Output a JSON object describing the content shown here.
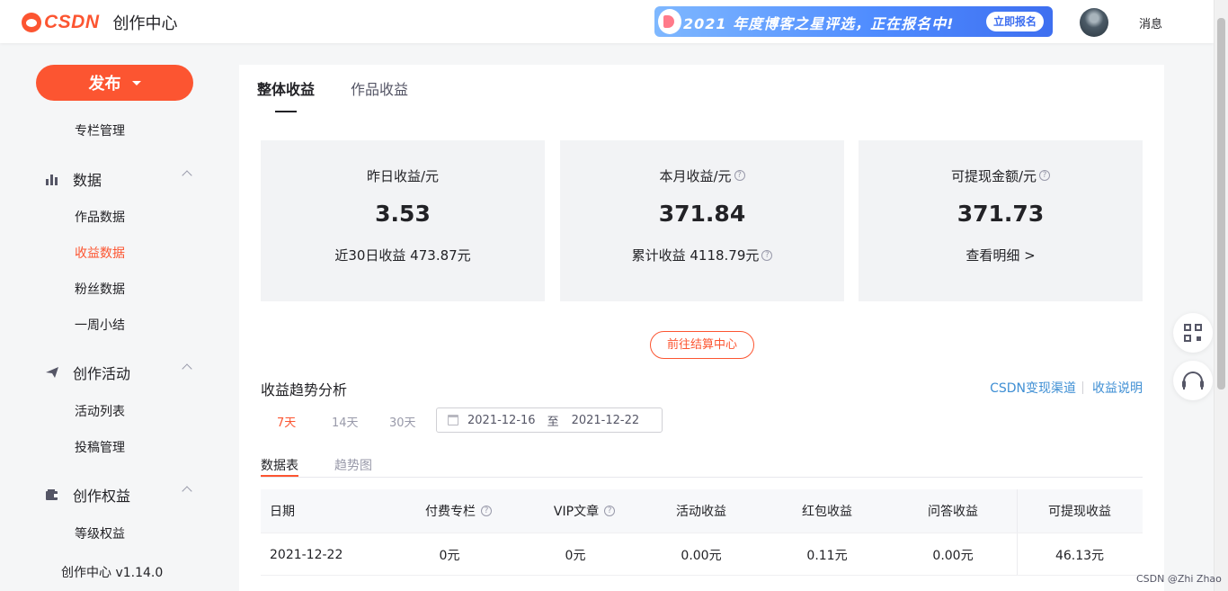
{
  "header": {
    "logo_text": "CSDN",
    "app_title": "创作中心",
    "banner_text": "2021 年度博客之星评选，正在报名中!",
    "banner_button": "立即报名",
    "messages_label": "消息"
  },
  "sidebar": {
    "publish_label": "发布",
    "column_manage": "专栏管理",
    "groups": [
      {
        "label": "数据",
        "icon": "bar-chart-icon",
        "items": [
          "作品数据",
          "收益数据",
          "粉丝数据",
          "一周小结"
        ],
        "active_item": "收益数据"
      },
      {
        "label": "创作活动",
        "icon": "paper-plane-icon",
        "items": [
          "活动列表",
          "投稿管理"
        ]
      },
      {
        "label": "创作权益",
        "icon": "wallet-icon",
        "items": [
          "等级权益"
        ]
      }
    ],
    "version": "创作中心 v1.14.0"
  },
  "main": {
    "tabs": [
      {
        "label": "整体收益",
        "active": true
      },
      {
        "label": "作品收益",
        "active": false
      }
    ],
    "stats": [
      {
        "label": "昨日收益/元",
        "value": "3.53",
        "footer": "近30日收益 473.87元",
        "help": false,
        "footer_help": false
      },
      {
        "label": "本月收益/元",
        "value": "371.84",
        "footer": "累计收益 4118.79元",
        "help": true,
        "footer_help": true
      },
      {
        "label": "可提现金额/元",
        "value": "371.73",
        "footer": "查看明细 >",
        "help": true,
        "footer_help": false
      }
    ],
    "settle_button": "前往结算中心",
    "trend_title": "收益趋势分析",
    "links": [
      "CSDN变现渠道",
      "收益说明"
    ],
    "ranges": [
      "7天",
      "14天",
      "30天"
    ],
    "active_range": "7天",
    "date_start": "2021-12-16",
    "date_to": "至",
    "date_end": "2021-12-22",
    "subtabs": [
      "数据表",
      "趋势图"
    ],
    "table": {
      "columns": [
        "日期",
        "付费专栏",
        "VIP文章",
        "活动收益",
        "红包收益",
        "问答收益",
        "可提现收益"
      ],
      "rows": [
        [
          "2021-12-22",
          "0元",
          "0元",
          "0.00元",
          "0.11元",
          "0.00元",
          "46.13元"
        ]
      ]
    }
  },
  "watermark": "CSDN @Zhi Zhao",
  "colors": {
    "accent": "#fc5531",
    "link": "#3f8fd4",
    "card_bg": "#f2f3f5"
  }
}
